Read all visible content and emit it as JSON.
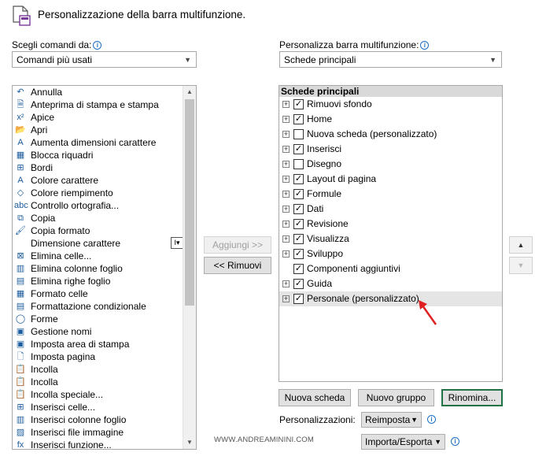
{
  "header": {
    "title": "Personalizzazione della barra multifunzione."
  },
  "left": {
    "label": "Scegli comandi da:",
    "combo_value": "Comandi più usati",
    "items": [
      {
        "label": "Annulla",
        "icon": "undo-icon",
        "glyph": "↶",
        "sub": true
      },
      {
        "label": "Anteprima di stampa e stampa",
        "icon": "print-preview-icon",
        "glyph": "🗎"
      },
      {
        "label": "Apice",
        "icon": "superscript-icon",
        "glyph": "x²"
      },
      {
        "label": "Apri",
        "icon": "open-folder-icon",
        "glyph": "📂"
      },
      {
        "label": "Aumenta dimensioni carattere",
        "icon": "font-size-increase-icon",
        "glyph": "A"
      },
      {
        "label": "Blocca riquadri",
        "icon": "freeze-panes-icon",
        "glyph": "▦",
        "sub": true
      },
      {
        "label": "Bordi",
        "icon": "borders-icon",
        "glyph": "⊞",
        "sub": true
      },
      {
        "label": "Colore carattere",
        "icon": "font-color-icon",
        "glyph": "A",
        "sub": true
      },
      {
        "label": "Colore riempimento",
        "icon": "fill-color-icon",
        "glyph": "◇",
        "sub": true
      },
      {
        "label": "Controllo ortografia...",
        "icon": "spelling-icon",
        "glyph": "abc"
      },
      {
        "label": "Copia",
        "icon": "copy-icon",
        "glyph": "⧉"
      },
      {
        "label": "Copia formato",
        "icon": "format-painter-icon",
        "glyph": "🖌"
      },
      {
        "label": "Dimensione carattere",
        "icon": "",
        "glyph": "",
        "box": true
      },
      {
        "label": "Elimina celle...",
        "icon": "delete-cells-icon",
        "glyph": "⊠"
      },
      {
        "label": "Elimina colonne foglio",
        "icon": "delete-columns-icon",
        "glyph": "▥"
      },
      {
        "label": "Elimina righe foglio",
        "icon": "delete-rows-icon",
        "glyph": "▤"
      },
      {
        "label": "Formato celle",
        "icon": "format-cells-icon",
        "glyph": "▦"
      },
      {
        "label": "Formattazione condizionale",
        "icon": "conditional-formatting-icon",
        "glyph": "▤",
        "sub": true
      },
      {
        "label": "Forme",
        "icon": "shapes-icon",
        "glyph": "◯",
        "sub": true
      },
      {
        "label": "Gestione nomi",
        "icon": "name-manager-icon",
        "glyph": "▣"
      },
      {
        "label": "Imposta area di stampa",
        "icon": "print-area-icon",
        "glyph": "▣"
      },
      {
        "label": "Imposta pagina",
        "icon": "page-setup-icon",
        "glyph": "🗋"
      },
      {
        "label": "Incolla",
        "icon": "paste-icon",
        "glyph": "📋"
      },
      {
        "label": "Incolla",
        "icon": "paste-icon",
        "glyph": "📋",
        "sub": true
      },
      {
        "label": "Incolla speciale...",
        "icon": "paste-special-icon",
        "glyph": "📋"
      },
      {
        "label": "Inserisci celle...",
        "icon": "insert-cells-icon",
        "glyph": "⊞"
      },
      {
        "label": "Inserisci colonne foglio",
        "icon": "insert-columns-icon",
        "glyph": "▥"
      },
      {
        "label": "Inserisci file immagine",
        "icon": "insert-picture-icon",
        "glyph": "▨"
      },
      {
        "label": "Inserisci funzione...",
        "icon": "insert-function-icon",
        "glyph": "fx"
      }
    ]
  },
  "middle": {
    "add_label": "Aggiungi >>",
    "remove_label": "<< Rimuovi"
  },
  "right": {
    "label": "Personalizza barra multifunzione:",
    "combo_value": "Schede principali",
    "tree_header": "Schede principali",
    "tabs": [
      {
        "label": "Rimuovi sfondo",
        "checked": true,
        "expander": true
      },
      {
        "label": "Home",
        "checked": true,
        "expander": true
      },
      {
        "label": "Nuova scheda (personalizzato)",
        "checked": false,
        "expander": true
      },
      {
        "label": "Inserisci",
        "checked": true,
        "expander": true
      },
      {
        "label": "Disegno",
        "checked": false,
        "expander": true
      },
      {
        "label": "Layout di pagina",
        "checked": true,
        "expander": true
      },
      {
        "label": "Formule",
        "checked": true,
        "expander": true
      },
      {
        "label": "Dati",
        "checked": true,
        "expander": true
      },
      {
        "label": "Revisione",
        "checked": true,
        "expander": true
      },
      {
        "label": "Visualizza",
        "checked": true,
        "expander": true
      },
      {
        "label": "Sviluppo",
        "checked": true,
        "expander": true
      },
      {
        "label": "Componenti aggiuntivi",
        "checked": true,
        "expander": false
      },
      {
        "label": "Guida",
        "checked": true,
        "expander": true
      },
      {
        "label": "Personale (personalizzato)",
        "checked": true,
        "expander": true,
        "selected": true
      }
    ],
    "new_tab_label": "Nuova scheda",
    "new_group_label": "Nuovo gruppo",
    "rename_label": "Rinomina...",
    "customizations_label": "Personalizzazioni:",
    "reset_label": "Reimposta",
    "import_export_label": "Importa/Esporta"
  },
  "watermark": "WWW.ANDREAMININI.COM",
  "colors": {
    "accent": "#217346",
    "arrow": "#e02020",
    "info": "#1e6fc5"
  }
}
